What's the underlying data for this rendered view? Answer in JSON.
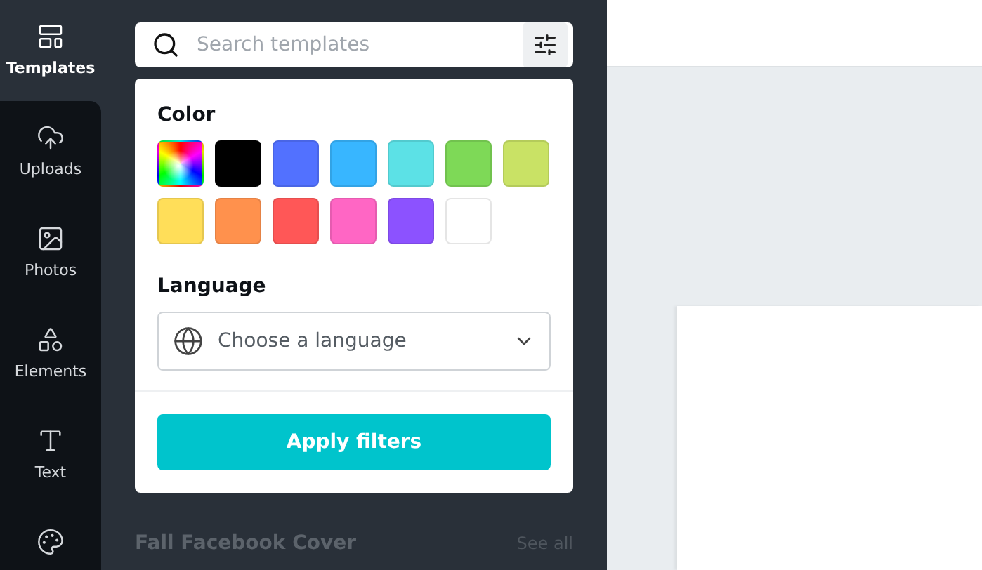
{
  "sidebar": {
    "items": [
      {
        "label": "Templates",
        "selected": true
      },
      {
        "label": "Uploads",
        "selected": false
      },
      {
        "label": "Photos",
        "selected": false
      },
      {
        "label": "Elements",
        "selected": false
      },
      {
        "label": "Text",
        "selected": false
      },
      {
        "selected": false
      }
    ]
  },
  "search": {
    "placeholder": "Search templates"
  },
  "filters": {
    "color_title": "Color",
    "colors": [
      {
        "kind": "rainbow"
      },
      {
        "kind": "solid",
        "color": "#000000"
      },
      {
        "kind": "solid",
        "color": "#5271ff"
      },
      {
        "kind": "solid",
        "color": "#38b6ff"
      },
      {
        "kind": "solid",
        "color": "#5ce1e6"
      },
      {
        "kind": "solid",
        "color": "#7ed957"
      },
      {
        "kind": "solid",
        "color": "#c9e265"
      },
      {
        "kind": "solid",
        "color": "#ffde59"
      },
      {
        "kind": "solid",
        "color": "#ff914d"
      },
      {
        "kind": "solid",
        "color": "#ff5757"
      },
      {
        "kind": "solid",
        "color": "#ff66c4"
      },
      {
        "kind": "solid",
        "color": "#8c52ff"
      },
      {
        "kind": "solid",
        "color": "#ffffff"
      }
    ],
    "language_title": "Language",
    "language_placeholder": "Choose a language",
    "apply": "Apply filters"
  },
  "section": {
    "title": "Fall Facebook Cover",
    "link": "See all"
  }
}
